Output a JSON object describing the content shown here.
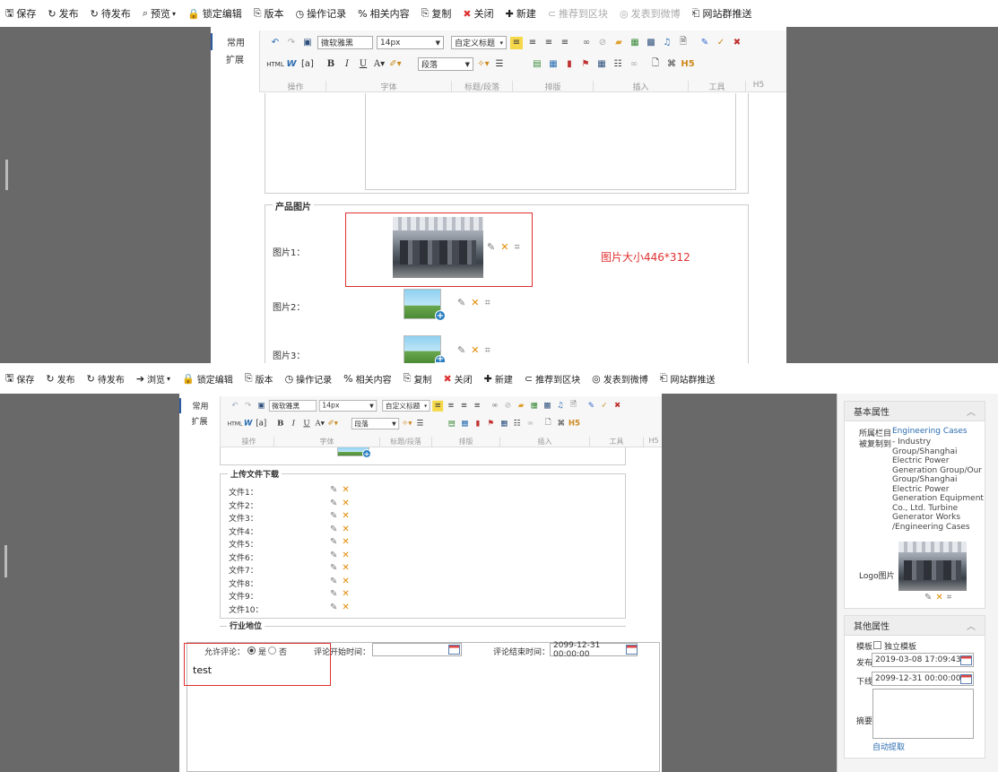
{
  "top": {
    "toolbar": {
      "save": "保存",
      "publish": "发布",
      "pending": "待发布",
      "preview": "预览",
      "lock": "锁定编辑",
      "version": "版本",
      "oplog": "操作记录",
      "related": "相关内容",
      "copy": "复制",
      "close": "关闭",
      "new": "新建",
      "recommend": "推荐到区块",
      "weibo": "发表到微博",
      "sitepush": "网站群推送"
    },
    "tabs": {
      "common": "常用",
      "extend": "扩展"
    },
    "font_select": "微软雅黑",
    "size_select": "14px",
    "heading_select": "自定义标题",
    "para_select": "段落",
    "groups": {
      "op": "操作",
      "font": "字体",
      "heading": "标题/段落",
      "layout": "排版",
      "insert": "插入",
      "tools": "工具",
      "h5": "H5"
    },
    "product": {
      "legend": "产品图片",
      "img1": "图片1：",
      "img2": "图片2：",
      "img3": "图片3：",
      "size_note": "图片大小446*312"
    }
  },
  "bottom": {
    "toolbar": {
      "save": "保存",
      "publish": "发布",
      "pending": "待发布",
      "browse": "浏览",
      "lock": "锁定编辑",
      "version": "版本",
      "oplog": "操作记录",
      "related": "相关内容",
      "copy": "复制",
      "close": "关闭",
      "new": "新建",
      "recommend": "推荐到区块",
      "weibo": "发表到微博",
      "sitepush": "网站群推送"
    },
    "tabs": {
      "common": "常用",
      "extend": "扩展"
    },
    "font_select": "微软雅黑",
    "size_select": "14px",
    "heading_select": "自定义标题",
    "para_select": "段落",
    "groups": {
      "op": "操作",
      "font": "字体",
      "heading": "标题/段落",
      "layout": "排版",
      "insert": "插入",
      "tools": "工具",
      "h5": "H5"
    },
    "upload": {
      "legend": "上传文件下载",
      "files": [
        "文件1：",
        "文件2：",
        "文件3：",
        "文件4：",
        "文件5：",
        "文件6：",
        "文件7：",
        "文件8：",
        "文件9：",
        "文件10："
      ]
    },
    "industry_legend": "行业地位",
    "comment": {
      "allow": "允许评论：",
      "yes": "是",
      "no": "否",
      "start_label": "评论开始时间：",
      "start_value": "",
      "end_label": "评论结束时间：",
      "end_value": "2099-12-31 00:00:00"
    },
    "editor_text": "test",
    "basic": {
      "title": "基本属性",
      "column_label": "所属栏目",
      "column_value": "Engineering Cases",
      "copied_label": "被复制到",
      "copied_value": "- Industry Group/Shanghai Electric Power Generation Group/Our Group/Shanghai Electric Power Generation Equipment Co., Ltd. Turbine Generator Works /Engineering Cases",
      "logo_label": "Logo图片"
    },
    "other": {
      "title": "其他属性",
      "template_label": "模板",
      "template_value": "独立模板",
      "publish_label": "发布",
      "publish_value": "2019-03-08 17:09:43",
      "offline_label": "下线",
      "offline_value": "2099-12-31 00:00:00",
      "summary_label": "摘要",
      "auto_extract": "自动提取"
    }
  }
}
